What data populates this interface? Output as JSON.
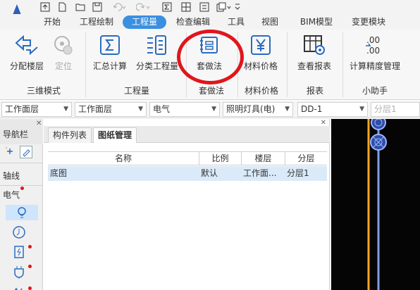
{
  "menu": {
    "tabs": [
      {
        "label": "开始"
      },
      {
        "label": "工程绘制"
      },
      {
        "label": "工程量"
      },
      {
        "label": "检查编辑"
      },
      {
        "label": "工具"
      },
      {
        "label": "视图"
      },
      {
        "label": "BIM模型"
      },
      {
        "label": "变更模块"
      }
    ],
    "active_tab": "工程量"
  },
  "ribbon": {
    "buttons": {
      "assign_floor": "分配楼层",
      "locate": "定位",
      "summary_calc": "汇总计算",
      "category_quantity": "分类工程量",
      "apply_method": "套做法",
      "material_price": "材料价格",
      "view_report": "查看报表",
      "precision_mgmt": "计算精度管理"
    },
    "groups": {
      "three_d_mode": "三维模式",
      "quantity": "工程量",
      "apply_method": "套做法",
      "material_price": "材料价格",
      "report": "报表",
      "assistant": "小助手"
    }
  },
  "toolbar": {
    "dropdowns": [
      "工作面层",
      "工作面层",
      "电气",
      "照明灯具(电)",
      "DD-1",
      "分层1"
    ]
  },
  "navigator": {
    "title": "导航栏",
    "items": [
      "轴线",
      "电气"
    ]
  },
  "panel": {
    "tabs": [
      "构件列表",
      "图纸管理"
    ],
    "active_tab": "图纸管理",
    "columns": [
      "名称",
      "比例",
      "楼层",
      "分层"
    ],
    "rows": [
      {
        "name": "底图",
        "scale": "默认",
        "floor": "工作面...",
        "layer": "分层1"
      }
    ]
  },
  "colors": {
    "accent": "#3b8fe0",
    "annotation": "#e0161c",
    "selected_row": "#dbeaf8",
    "canvas": "#050505"
  }
}
